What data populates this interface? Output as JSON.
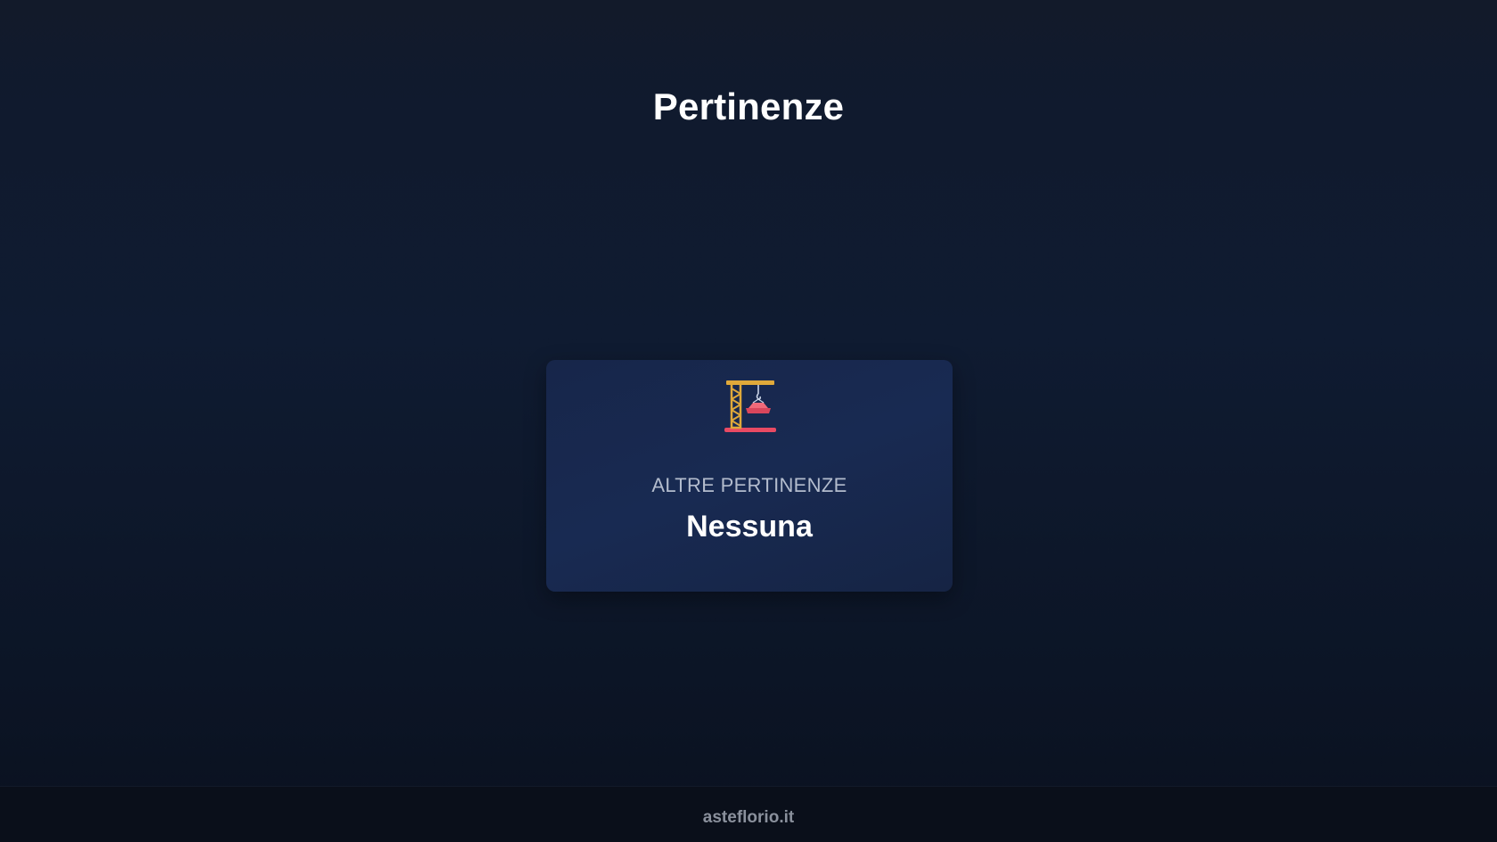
{
  "page": {
    "title": "Pertinenze"
  },
  "card": {
    "icon": "construction-crane-icon",
    "label": "ALTRE PERTINENZE",
    "value": "Nessuna"
  },
  "footer": {
    "site": "asteflorio.it"
  },
  "colors": {
    "background": "#0f1b31",
    "card": "#17264a",
    "label": "#b3bccd",
    "footer_text": "#8a909c"
  }
}
